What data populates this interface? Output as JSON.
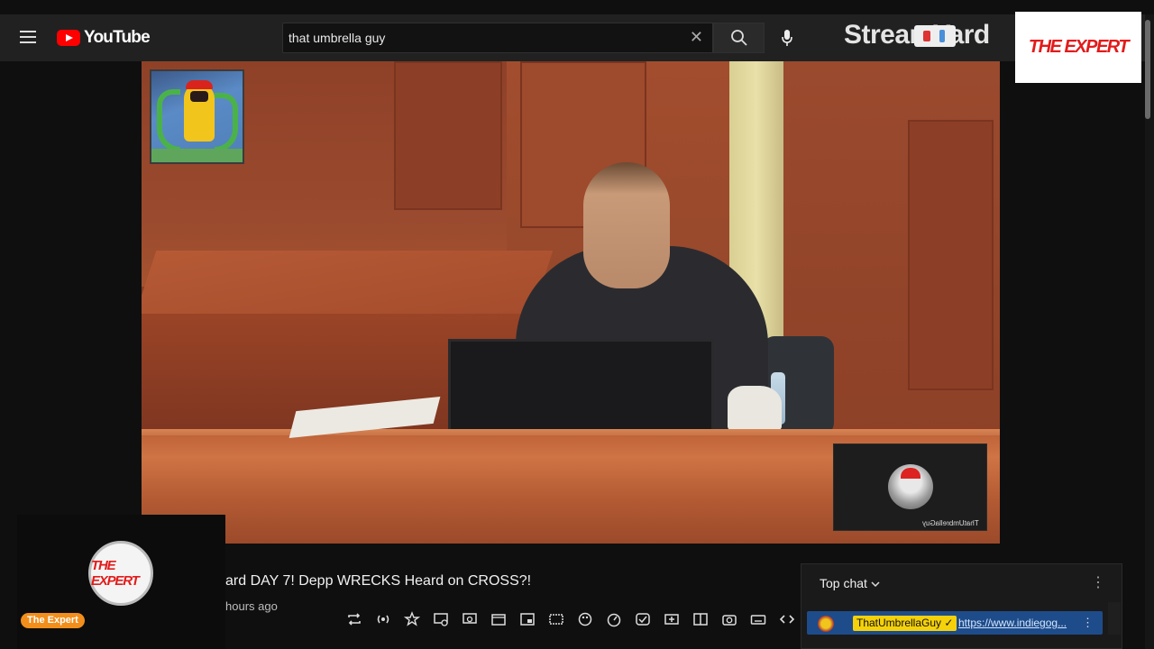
{
  "header": {
    "logo_text": "YouTube",
    "search_value": "that umbrella guy",
    "search_clear": "✕",
    "streamyard_text": "StreamYard",
    "expert_badge_text": "THE EXPERT"
  },
  "video": {
    "cam_name": "ThatUmbrellaGuy"
  },
  "channel": {
    "logo_text": "THE EXPERT",
    "name_pill": "The Expert"
  },
  "details": {
    "title": "ard DAY 7! Depp WRECKS Heard on CROSS?!",
    "meta": "hours ago"
  },
  "toolbar": {
    "icons": [
      "repeat-icon",
      "broadcast-icon",
      "star-icon",
      "screen-block-icon",
      "screen-view-icon",
      "film-icon",
      "picture-in-picture-icon",
      "subtitles-icon",
      "palette-icon",
      "speed-icon",
      "check-icon",
      "add-screen-icon",
      "split-icon",
      "camera-icon",
      "keyboard-icon",
      "code-icon"
    ]
  },
  "chat": {
    "title": "Top chat",
    "more": "⋮",
    "message_author": "ThatUmbrellaGuy ✓",
    "message_text": "https://www.indiegog...",
    "message_more": "⋮"
  },
  "colors": {
    "background": "#0f0f0f",
    "topbar": "#212121",
    "youtube_red": "#ff0000",
    "expert_red": "#e21b1b",
    "pill_orange": "#f28e1c",
    "chat_highlight": "#1e4c8a",
    "author_yellow": "#f4d10a"
  }
}
